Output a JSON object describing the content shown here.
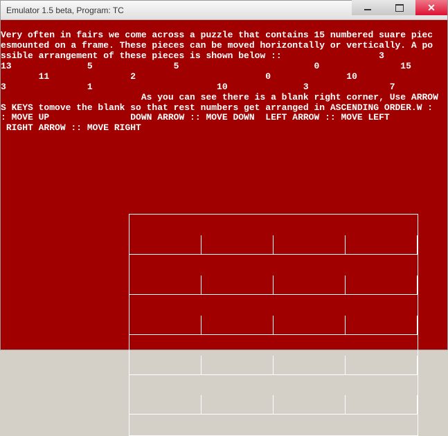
{
  "titlebar": {
    "title": "Emulator 1.5 beta, Program:     TC"
  },
  "text": {
    "line1": "Very often in fairs we come across a puzzle that contains 15 numbered suare piec",
    "line2": "esmounted on a frame. These pieces can be moved horizontally or vertically. A po",
    "line3": "ssible arrangement of these pieces is shown below ::                  3",
    "line4": "13              5               5                         0               15",
    "line5": "       11               2                        0              10",
    "line6": "3               1                       10              3               7",
    "line7": "                          As you can see there is a blank right corner, Use ARROW",
    "line8": "S KEYS tomove the blank so that rest numbers get arranged in ASCENDING ORDER.W :",
    "line9": ": MOVE UP               DOWN ARROW :: MOVE DOWN  LEFT ARROW :: MOVE LEFT",
    "line10": " RIGHT ARROW :: MOVE RIGHT"
  },
  "grid": {
    "rows": 5,
    "cols": 4
  }
}
